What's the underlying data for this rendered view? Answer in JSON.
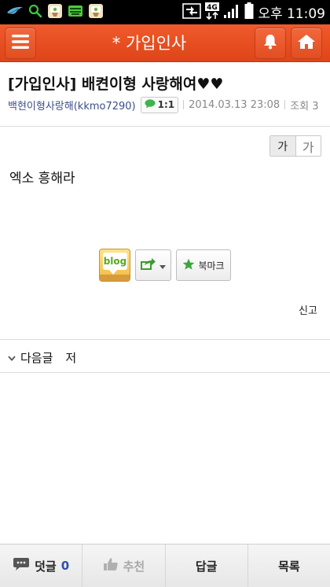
{
  "status_bar": {
    "time": "오후 11:09",
    "network": "4G",
    "icons": [
      "bird-icon",
      "search-icon",
      "app-icon",
      "keyboard-icon",
      "app-icon-2",
      "data-sync-icon",
      "signal-icon",
      "battery-icon"
    ]
  },
  "app_bar": {
    "title": "* 가입인사",
    "menu_icon": "hamburger-icon",
    "bell_icon": "bell-icon",
    "home_icon": "home-icon"
  },
  "post": {
    "title": "[가입인사] 배켠이형 사랑해여♥♥",
    "author": "백현이형사랑해(kkmo7290)",
    "reply_badge": "1:1",
    "date": "2014.03.13 23:08",
    "views": "조회 3",
    "body": "엑소 흥해라"
  },
  "font_size": {
    "small": "가",
    "large": "가"
  },
  "actions": {
    "blog": "blog",
    "bookmark": "북마크"
  },
  "report": "신고",
  "next_post": {
    "label": "다음글",
    "title": "저"
  },
  "bottom_bar": {
    "comments_label": "덧글",
    "comments_count": "0",
    "recommend_label": "추천",
    "reply_label": "답글",
    "list_label": "목록"
  },
  "colors": {
    "app_bar": "#e9532a",
    "author": "#3c4f8c",
    "count": "#2f4fa8"
  }
}
